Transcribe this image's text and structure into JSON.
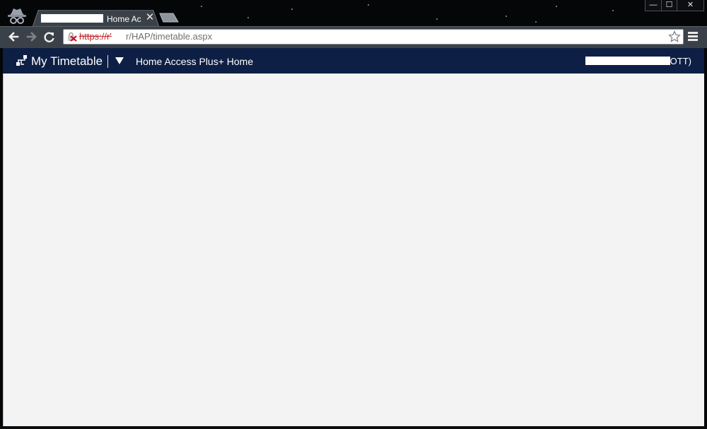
{
  "browser": {
    "tab": {
      "title": "Home Acc",
      "close_glyph": "✕"
    },
    "window_controls": {
      "minimize_glyph": "—",
      "maximize_glyph": "☐",
      "close_glyph": "✕"
    },
    "omnibox": {
      "scheme": "https://r'",
      "host": "",
      "path": "r/HAP/timetable.aspx",
      "security_icon": "insecure-lock-icon",
      "bookmark_icon": "star-icon"
    },
    "nav_icons": [
      "back-icon",
      "forward-icon",
      "reload-icon",
      "menu-icon"
    ],
    "incognito_icon": "incognito-icon"
  },
  "app": {
    "title": "My Timetable",
    "home_link": "Home Access Plus+ Home",
    "user_suffix": "OTT)",
    "colors": {
      "header_bg": "#0d1f44",
      "content_bg": "#f3f3f3"
    }
  }
}
